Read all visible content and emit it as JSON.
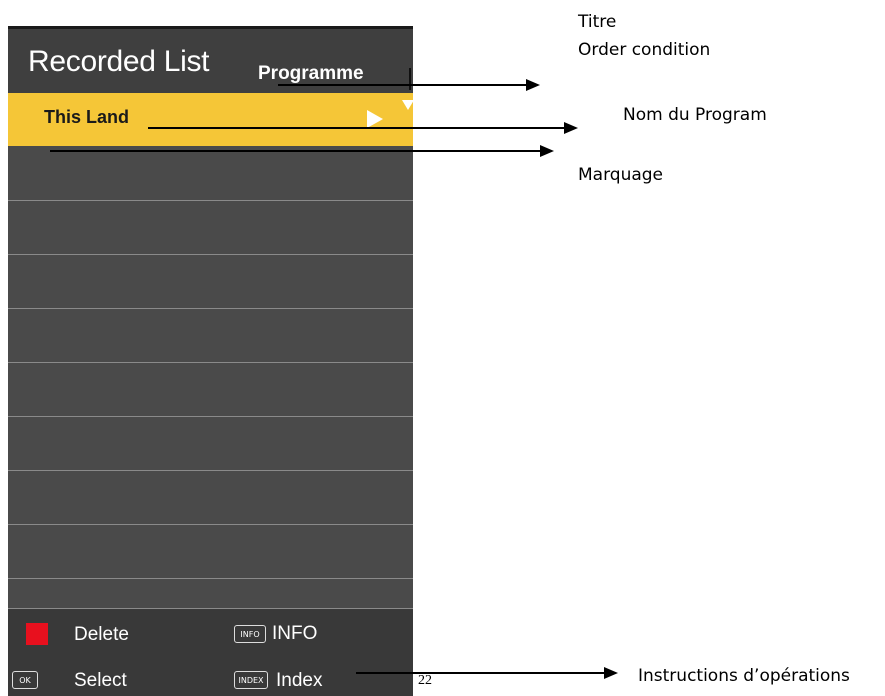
{
  "panel": {
    "title": "Recorded List",
    "order_condition": "Programme",
    "rows": [
      {
        "label": "This Land",
        "selected": true
      },
      {
        "label": "",
        "selected": false
      },
      {
        "label": "",
        "selected": false
      },
      {
        "label": "",
        "selected": false
      },
      {
        "label": "",
        "selected": false
      },
      {
        "label": "",
        "selected": false
      },
      {
        "label": "",
        "selected": false
      },
      {
        "label": "",
        "selected": false
      },
      {
        "label": "",
        "selected": false
      },
      {
        "label": "",
        "selected": false
      }
    ],
    "footer": {
      "delete_label": "Delete",
      "info_key": "INFO",
      "info_label": "INFO",
      "ok_key": "OK",
      "select_label": "Select",
      "index_key": "INDEX",
      "index_label": "Index"
    }
  },
  "page_number": "22",
  "annotations": {
    "titre": "Titre",
    "order_condition": "Order condition",
    "nom_du_program": "Nom du Program",
    "marquage": "Marquage",
    "instructions": "Instructions d’opérations"
  },
  "colors": {
    "selected_row": "#f5c637",
    "panel_bg": "#4a4a4a",
    "delete_key": "#e8101e"
  }
}
